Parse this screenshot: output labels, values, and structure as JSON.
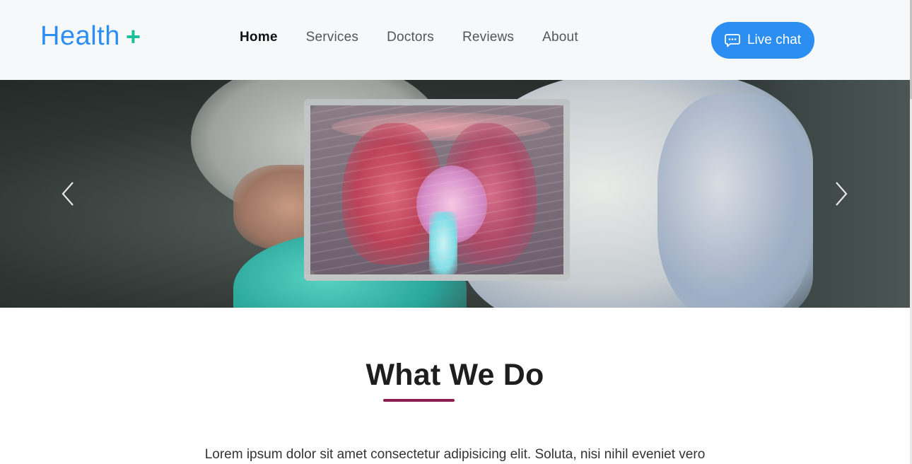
{
  "header": {
    "logo_text": "Health",
    "logo_symbol": "+",
    "nav": [
      {
        "label": "Home",
        "active": true
      },
      {
        "label": "Services",
        "active": false
      },
      {
        "label": "Doctors",
        "active": false
      },
      {
        "label": "Reviews",
        "active": false
      },
      {
        "label": "About",
        "active": false
      }
    ],
    "live_chat_label": "Live chat",
    "live_chat_icon": "chat-bubble-icon"
  },
  "hero": {
    "image_subject": "doctor holding chest x-ray slide",
    "prev_icon": "chevron-left-icon",
    "next_icon": "chevron-right-icon"
  },
  "section": {
    "title": "What We Do",
    "lead": "Lorem ipsum dolor sit amet consectetur adipisicing elit. Soluta, nisi nihil eveniet vero"
  },
  "colors": {
    "brand_blue": "#2b8ef0",
    "plus_green": "#1dbf9a",
    "underline": "#8b1e4f",
    "header_bg": "#f7f8fa"
  }
}
